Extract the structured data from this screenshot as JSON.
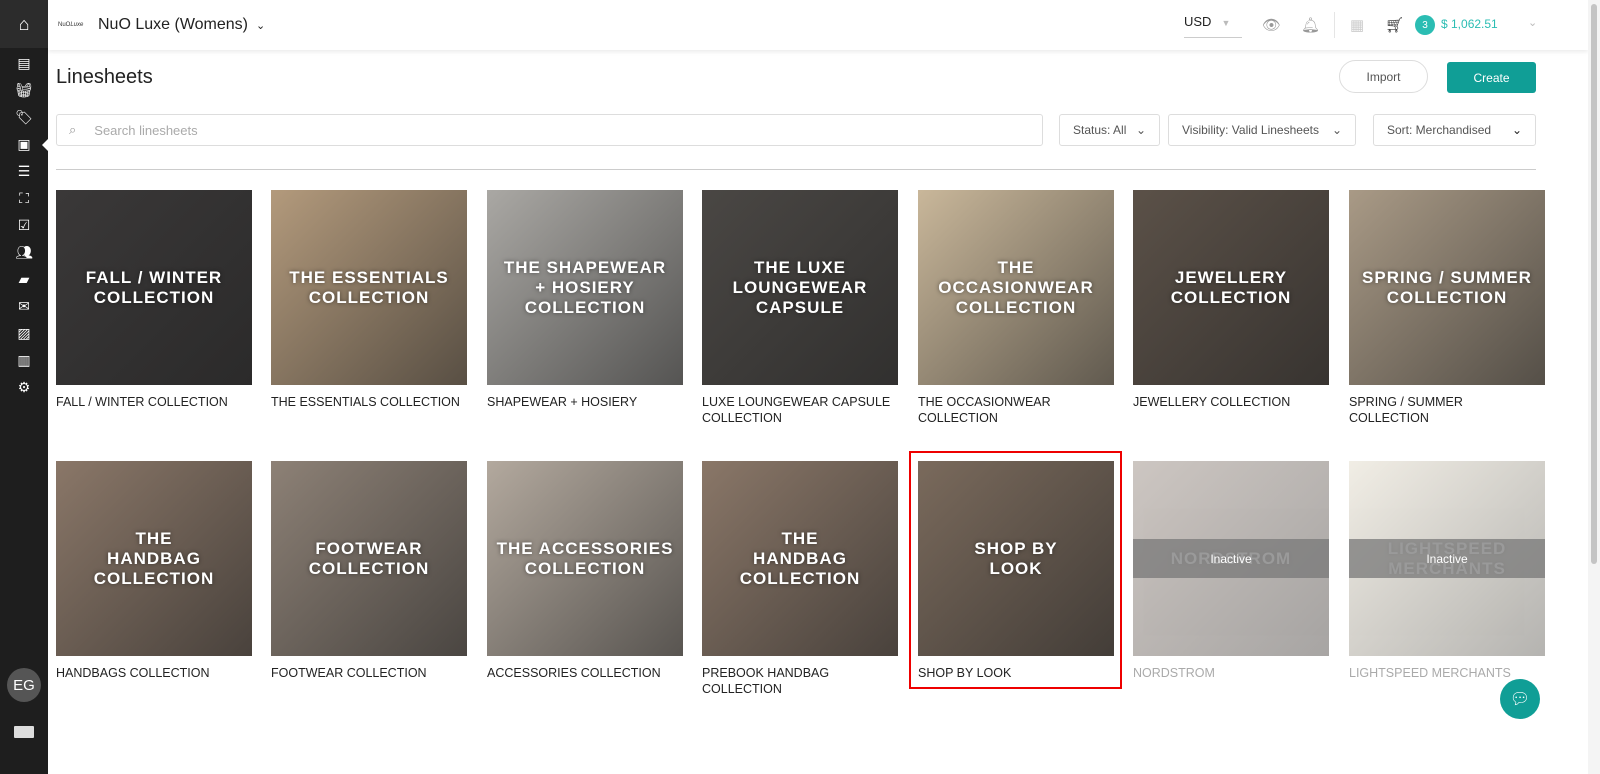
{
  "header": {
    "store_name": "NuO Luxe (Womens)",
    "logo_text": "NuO Luxe",
    "currency": "USD",
    "cart_count": "3",
    "cart_total": "$ 1,062.51"
  },
  "sidebar": {
    "user_initials": "EG",
    "items": [
      "store-icon",
      "basket-icon",
      "tag-icon",
      "linesheets-icon",
      "catalog-icon",
      "presentation-icon",
      "checklist-icon",
      "users-icon",
      "box-icon",
      "email-icon",
      "images-icon",
      "reports-icon",
      "settings-icon"
    ],
    "active": "linesheets-icon"
  },
  "page": {
    "title": "Linesheets",
    "import_label": "Import",
    "create_label": "Create",
    "search_placeholder": "Search linesheets",
    "status_filter": "Status: All",
    "visibility_filter": "Visibility: Valid Linesheets",
    "sort": "Sort: Merchandised"
  },
  "accent_color": "#109e96",
  "linesheets": [
    {
      "title": "FALL / WINTER COLLECTION",
      "overlay": "FALL / WINTER\nCOLLECTION",
      "status": "active",
      "bg": "#3a3838"
    },
    {
      "title": "THE ESSENTIALS COLLECTION",
      "overlay": "THE ESSENTIALS\nCOLLECTION",
      "status": "active",
      "bg": "#b39a7c"
    },
    {
      "title": "SHAPEWEAR + HOSIERY",
      "overlay": "THE SHAPEWEAR\n+ HOSIERY\nCOLLECTION",
      "status": "active",
      "bg": "#aaa8a4"
    },
    {
      "title": "LUXE LOUNGEWEAR CAPSULE COLLECTION",
      "overlay": "THE LUXE\nLOUNGEWEAR\nCAPSULE",
      "status": "active",
      "bg": "#4a4744"
    },
    {
      "title": "THE OCCASIONWEAR COLLECTION",
      "overlay": "THE\nOCCASIONWEAR\nCOLLECTION",
      "status": "active",
      "bg": "#c9b79a"
    },
    {
      "title": "JEWELLERY COLLECTION",
      "overlay": "JEWELLERY\nCOLLECTION",
      "status": "active",
      "bg": "#5b5148"
    },
    {
      "title": "SPRING / SUMMER COLLECTION",
      "overlay": "SPRING / SUMMER\nCOLLECTION",
      "status": "active",
      "bg": "#a99a86"
    },
    {
      "title": "HANDBAGS COLLECTION",
      "overlay": "THE\nHANDBAG\nCOLLECTION",
      "status": "active",
      "bg": "#8a7768"
    },
    {
      "title": "FOOTWEAR COLLECTION",
      "overlay": "FOOTWEAR\nCOLLECTION",
      "status": "active",
      "bg": "#8d8176"
    },
    {
      "title": "ACCESSORIES COLLECTION",
      "overlay": "THE ACCESSORIES\nCOLLECTION",
      "status": "active",
      "bg": "#b3a99e"
    },
    {
      "title": "PREBOOK HANDBAG COLLECTION",
      "overlay": "THE\nHANDBAG\nCOLLECTION",
      "status": "active",
      "bg": "#8a7768"
    },
    {
      "title": "SHOP BY LOOK",
      "overlay": "SHOP BY\nLOOK",
      "status": "active",
      "bg": "#7a6a5c"
    },
    {
      "title": "NORDSTROM",
      "overlay": "NORDSTROM",
      "status": "Inactive",
      "bg": "#9a8d84"
    },
    {
      "title": "LIGHTSPEED MERCHANTS",
      "overlay": "LIGHTSPEED\nMERCHANTS",
      "status": "Inactive",
      "bg": "#e3dccb"
    }
  ]
}
